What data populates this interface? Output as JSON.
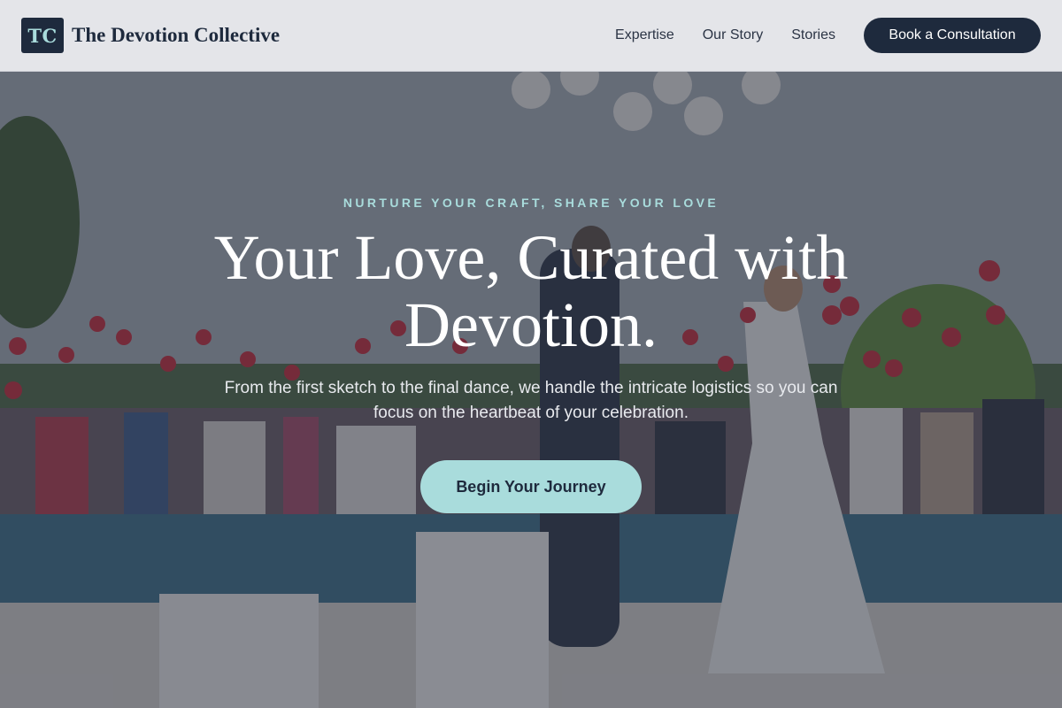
{
  "brand": {
    "logo_initials": "TC",
    "name": "The Devotion Collective"
  },
  "nav": {
    "items": [
      {
        "label": "Expertise"
      },
      {
        "label": "Our Story"
      },
      {
        "label": "Stories"
      }
    ],
    "cta_label": "Book a Consultation"
  },
  "hero": {
    "eyebrow": "NURTURE YOUR CRAFT, SHARE YOUR LOVE",
    "headline": "Your Love, Curated with Devotion.",
    "subtext": "From the first sketch to the final dance, we handle the intricate logistics so you can focus on the heartbeat of your celebration.",
    "button_label": "Begin Your Journey",
    "background_image": "wedding-couple-balloons-photo"
  },
  "colors": {
    "navy": "#1e2a3d",
    "accent_teal": "#a9dcdc",
    "header_bg": "#e4e5e9",
    "balloon_red": "#c8283a"
  }
}
